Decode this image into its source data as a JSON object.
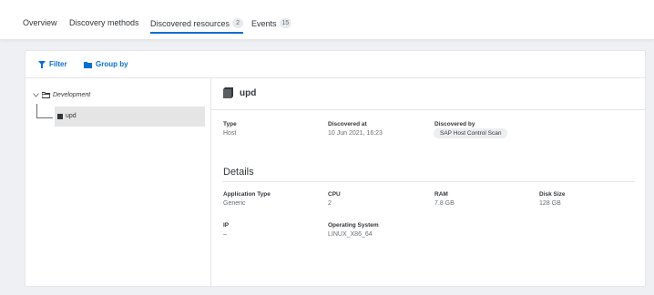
{
  "tabs": [
    {
      "label": "Overview"
    },
    {
      "label": "Discovery methods"
    },
    {
      "label": "Discovered resources",
      "badge": "2"
    },
    {
      "label": "Events",
      "badge": "15"
    }
  ],
  "toolbar": {
    "filter_label": "Filter",
    "group_label": "Group by"
  },
  "tree": {
    "root_label": "Development",
    "child_label": "upd"
  },
  "resource": {
    "name": "upd",
    "type_label": "Type",
    "type_value": "Host",
    "discovered_at_label": "Discovered at",
    "discovered_at_value": "10 Jun 2021, 16:23",
    "discovered_by_label": "Discovered by",
    "discovered_by_value": "SAP Host Control Scan"
  },
  "details": {
    "title": "Details",
    "app_type_label": "Application Type",
    "app_type_value": "Generic",
    "cpu_label": "CPU",
    "cpu_value": "2",
    "ram_label": "RAM",
    "ram_value": "7.8 GB",
    "disk_label": "Disk Size",
    "disk_value": "128 GB",
    "ip_label": "IP",
    "ip_value": "–",
    "os_label": "Operating System",
    "os_value": "LINUX_X86_64"
  },
  "colors": {
    "accent": "#0a6ed1",
    "text": "#32363a",
    "muted": "#6a6d70",
    "selection": "#e5e5e5"
  }
}
